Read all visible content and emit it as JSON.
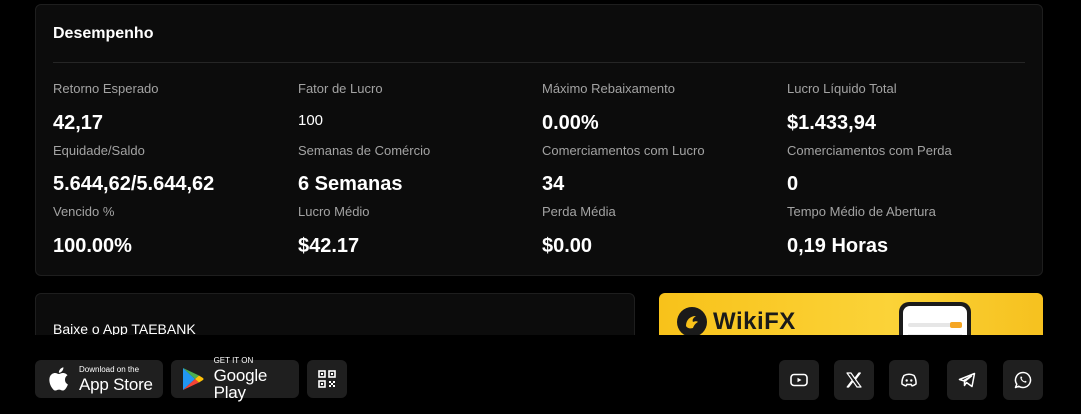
{
  "performance": {
    "title": "Desempenho",
    "stats": [
      {
        "label": "Retorno Esperado",
        "value": "42,17"
      },
      {
        "label": "Fator de Lucro",
        "value": "100"
      },
      {
        "label": "Máximo Rebaixamento",
        "value": "0.00%"
      },
      {
        "label": "Lucro Líquido Total",
        "value": "$1.433,94"
      },
      {
        "label": "Equidade/Saldo",
        "value": "5.644,62/5.644,62"
      },
      {
        "label": "Semanas de Comércio",
        "value": "6 Semanas"
      },
      {
        "label": "Comerciamentos com Lucro",
        "value": "34"
      },
      {
        "label": "Comerciamentos com Perda",
        "value": "0"
      },
      {
        "label": "Vencido %",
        "value": "100.00%"
      },
      {
        "label": "Lucro Médio",
        "value": "$42.17"
      },
      {
        "label": "Perda Média",
        "value": "$0.00"
      },
      {
        "label": "Tempo Médio de Abertura",
        "value": "0,19 Horas"
      }
    ]
  },
  "app_download": {
    "title": "Baixe o App TAEBANK"
  },
  "banner": {
    "brand": "WikiFX",
    "colors": {
      "background": "#f8c21a",
      "text": "#1a1a1a"
    }
  },
  "footer": {
    "app_store": {
      "sub": "Download on the",
      "main": "App Store",
      "icon": "apple-icon"
    },
    "google_play": {
      "sub": "GET IT ON",
      "main": "Google Play",
      "icon": "google-play-icon"
    },
    "qr_icon": "qr-code-icon",
    "social": [
      "youtube-icon",
      "x-icon",
      "discord-icon",
      "telegram-icon",
      "whatsapp-icon"
    ]
  }
}
